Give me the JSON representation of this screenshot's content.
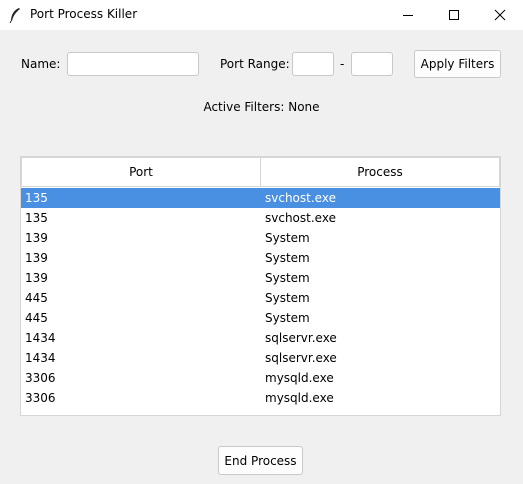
{
  "window": {
    "title": "Port Process Killer"
  },
  "filters": {
    "name_label": "Name:",
    "name_value": "",
    "port_range_label": "Port Range:",
    "range_from_value": "",
    "range_separator": "-",
    "range_to_value": "",
    "apply_button_label": "Apply Filters"
  },
  "status": {
    "active_filters_text": "Active Filters: None"
  },
  "table": {
    "columns": [
      "Port",
      "Process"
    ],
    "selected_row_index": 0,
    "rows": [
      {
        "port": "135",
        "process": "svchost.exe"
      },
      {
        "port": "135",
        "process": "svchost.exe"
      },
      {
        "port": "139",
        "process": "System"
      },
      {
        "port": "139",
        "process": "System"
      },
      {
        "port": "139",
        "process": "System"
      },
      {
        "port": "445",
        "process": "System"
      },
      {
        "port": "445",
        "process": "System"
      },
      {
        "port": "1434",
        "process": "sqlservr.exe"
      },
      {
        "port": "1434",
        "process": "sqlservr.exe"
      },
      {
        "port": "3306",
        "process": "mysqld.exe"
      },
      {
        "port": "3306",
        "process": "mysqld.exe"
      }
    ]
  },
  "actions": {
    "end_process_label": "End Process"
  },
  "colors": {
    "selection": "#4a90e2",
    "window_bg": "#f0f0f0"
  }
}
